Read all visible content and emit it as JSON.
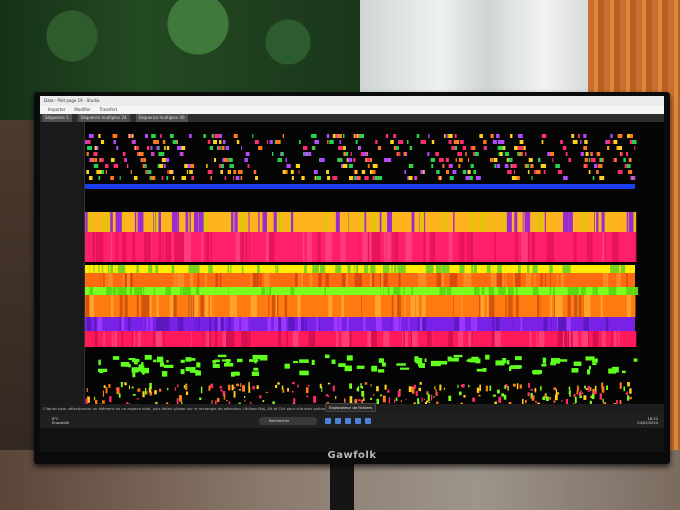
{
  "brand": "Gawfolk",
  "screen": {
    "title": "Data - Plot page 19 - Studio",
    "ribbon": [
      "Importer",
      "Modifier",
      "Transfert"
    ],
    "toolbar": [
      "Séquence 1",
      "Séquence multiplex 24",
      "Séquence multiplex 40"
    ],
    "status_text": "Cliquez pour sélectionner un élément ou un espace vide, puis faites glisser sur le rectangle de sélection. Utilisez Maj, Alt et Ctrl pour d'autres options.",
    "taskbar": {
      "weather_temp": "8°C",
      "weather_desc": "Ensoleillé",
      "search_label": "Rechercher",
      "tooltip": "Explorateur de fichiers",
      "time": "18:52",
      "date": "04/02/2024"
    }
  }
}
